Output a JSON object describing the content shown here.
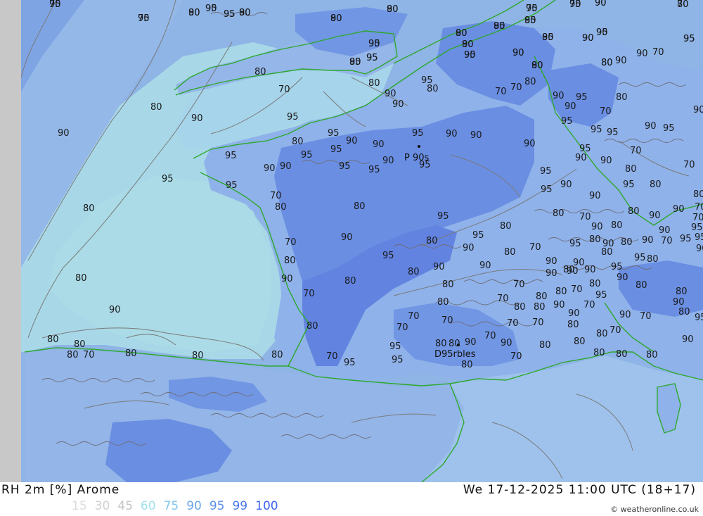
{
  "map": {
    "kind": "relative humidity contour map",
    "colors": {
      "left_strip": "#c8c8c8",
      "bg": "#8fb4e6",
      "sea_light": "#a8d8e8",
      "light_70": "#b4dcee",
      "mid_80": "#9fc4ec",
      "dark_95": "#6688e0",
      "dark_99": "#5b7fe3",
      "coast": "#2ea82e",
      "contour": "#7a7a7a"
    },
    "city_labels": [
      {
        "text": "P 90s"
      },
      {
        "text": "D95rbles"
      }
    ],
    "contour_labels": [
      "95",
      "95",
      "90",
      "90",
      "95",
      "90",
      "90",
      "90",
      "95",
      "95",
      "90",
      "70",
      "95",
      "95",
      "90",
      "90",
      "95",
      "90",
      "95",
      "95",
      "90",
      "95",
      "95",
      "95",
      "90",
      "90",
      "80",
      "90",
      "90",
      "70",
      "80",
      "80",
      "70",
      "90",
      "95",
      "80",
      "70",
      "70",
      "80",
      "90",
      "90",
      "95",
      "80",
      "70",
      "80",
      "90",
      "95",
      "90",
      "90",
      "95",
      "95",
      "95",
      "90",
      "95",
      "90",
      "95",
      "90",
      "90",
      "95",
      "90",
      "90",
      "90",
      "80",
      "95",
      "95",
      "95",
      "90",
      "95",
      "95",
      "95",
      "90",
      "90",
      "95",
      "90",
      "90",
      "70",
      "70",
      "80",
      "95",
      "95",
      "95",
      "95",
      "90",
      "90",
      "95",
      "80",
      "80",
      "70",
      "80",
      "80",
      "70",
      "90",
      "80",
      "95",
      "80",
      "80",
      "70",
      "80",
      "90",
      "80",
      "90",
      "70",
      "95",
      "90",
      "95",
      "90",
      "80",
      "90",
      "80",
      "70",
      "95",
      "80",
      "90",
      "80",
      "90",
      "70",
      "95",
      "90",
      "95",
      "70",
      "95",
      "90",
      "90",
      "80",
      "90",
      "90",
      "80",
      "95",
      "80",
      "80",
      "80",
      "90",
      "90",
      "90",
      "95",
      "90",
      "80",
      "90",
      "80",
      "80",
      "70",
      "80",
      "80",
      "70",
      "80",
      "70",
      "80",
      "80",
      "70",
      "95",
      "80",
      "90",
      "80",
      "80",
      "90",
      "70",
      "90",
      "80",
      "95",
      "90",
      "90",
      "70",
      "70",
      "70",
      "70",
      "70",
      "80",
      "80",
      "80",
      "70",
      "80",
      "70",
      "70",
      "80",
      "80",
      "70",
      "80",
      "80",
      "80",
      "95",
      "80",
      "80",
      "90",
      "90",
      "80",
      "80",
      "90",
      "80",
      "80",
      "80",
      "70",
      "95",
      "95",
      "80",
      "70",
      "70",
      "70",
      "80",
      "95",
      "95",
      "80",
      "80",
      "80",
      "70",
      "70",
      "90",
      "80",
      "80",
      "80",
      "80",
      "80",
      "80",
      "90",
      "90",
      "95",
      "95",
      "95",
      "80",
      "90",
      "90",
      "80",
      "80"
    ]
  },
  "footer": {
    "title": "RH 2m [%] Arome",
    "datetime": "We 17-12-2025 11:00 UTC (18+17)",
    "legend": [
      {
        "label": "15",
        "color": "#dcdcdc"
      },
      {
        "label": "30",
        "color": "#d0d0d0"
      },
      {
        "label": "45",
        "color": "#c4c4c4"
      },
      {
        "label": "60",
        "color": "#a0e0ec"
      },
      {
        "label": "75",
        "color": "#80c8e8"
      },
      {
        "label": "90",
        "color": "#6aa8e8"
      },
      {
        "label": "95",
        "color": "#5a90ec"
      },
      {
        "label": "99",
        "color": "#4a78ee"
      },
      {
        "label": "100",
        "color": "#3d63f0"
      }
    ],
    "credit": "© weatheronline.co.uk"
  }
}
